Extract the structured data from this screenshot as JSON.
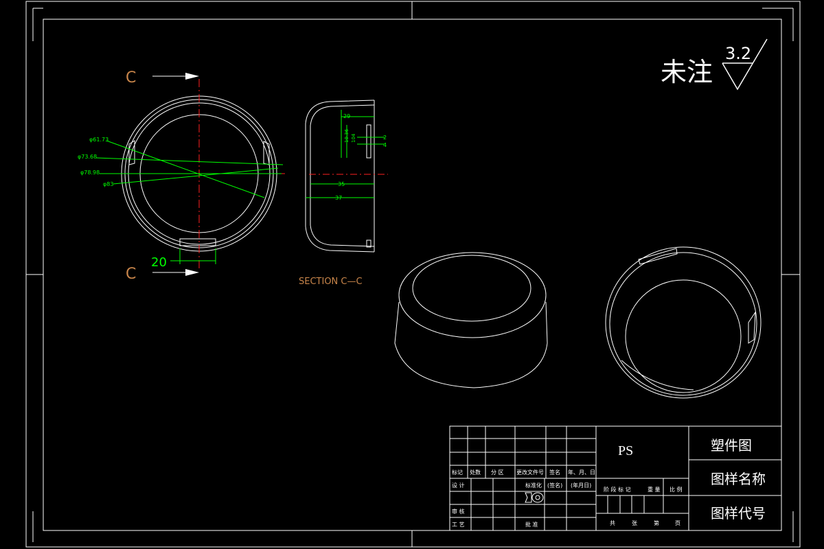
{
  "drawing": {
    "roughness_note": {
      "label": "未注",
      "value": "3.2"
    },
    "section_marks": {
      "top": "C",
      "bottom": "C",
      "caption": "SECTION C—C"
    },
    "front_view": {
      "diameters": [
        "φ61.73",
        "φ73.68",
        "φ78.98",
        "φ83"
      ],
      "slot_width": "20"
    },
    "section_view": {
      "dims": [
        "29",
        "10.36",
        "104",
        "2",
        "4",
        "35",
        "37"
      ]
    }
  },
  "title_block": {
    "material": "PS",
    "part_name": "塑件图",
    "drawing_name_label": "图样名称",
    "drawing_code_label": "图样代号",
    "rev_headers": [
      "标记",
      "处数",
      "分 区",
      "更改文件号",
      "签名",
      "年、月、日"
    ],
    "roles": [
      "设 计",
      "审 核",
      "工 艺"
    ],
    "std_label": "标准化",
    "sign_label": "(签名)",
    "date_label": "(年月日)",
    "approve_label": "批 准",
    "stage_headers": [
      "阶 段 标 记",
      "重 量",
      "比 例"
    ],
    "sheet_labels": [
      "共",
      "张",
      "第",
      "页"
    ]
  }
}
